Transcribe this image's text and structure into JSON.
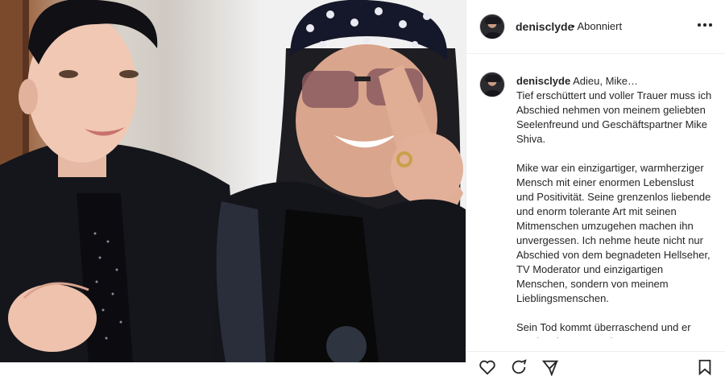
{
  "post": {
    "username": "denisclyde",
    "follow_status": "• Abonniert",
    "caption_title": "Adieu, Mike…",
    "caption_body": "Tief erschüttert und voller Trauer muss ich Abschied nehmen von meinem geliebten Seelenfreund und Geschäftspartner Mike Shiva.\n\nMike war ein einzigartiger, warmherziger Mensch mit einer enormen Lebenslust und Positivität. Seine grenzenlos liebende und enorm tolerante Art mit seinen Mitmenschen umzugehen machen ihn unvergessen. Ich nehme heute nicht nur Abschied von dem begnadeten Hellseher, TV Moderator und einzigartigen Menschen, sondern von meinem Lieblingsmenschen.\n\nSein Tod kommt überraschend und er wurde mitten aus seinem enormen"
  },
  "icons": {
    "more": "more-horizontal-icon",
    "like": "heart-icon",
    "comment": "comment-icon",
    "share": "share-icon",
    "save": "bookmark-icon"
  },
  "colors": {
    "text": "#262626",
    "border": "#efefef"
  }
}
